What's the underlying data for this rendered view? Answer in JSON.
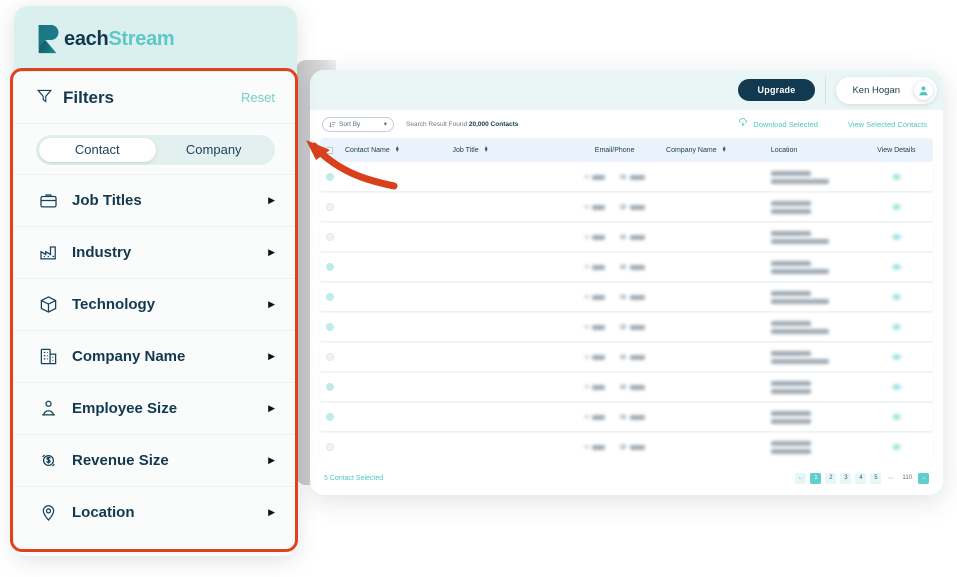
{
  "brand": {
    "logo_text_primary": "each",
    "logo_text_secondary": "Stream",
    "logo_mark": "reachstream-r-logo",
    "color_dark": "#12394f",
    "color_teal": "#5fc8c7",
    "annotation_color": "#e0421a"
  },
  "sidebar": {
    "filters_title": "Filters",
    "filters_icon": "funnel-icon",
    "reset_label": "Reset",
    "toggle": {
      "options": [
        "Contact",
        "Company"
      ],
      "selected": "Contact"
    },
    "items": [
      {
        "label": "Job Titles",
        "icon": "briefcase-icon",
        "chevron": "▶"
      },
      {
        "label": "Industry",
        "icon": "factory-icon",
        "chevron": "▶"
      },
      {
        "label": "Technology",
        "icon": "cube-stack-icon",
        "chevron": "▶"
      },
      {
        "label": "Company Name",
        "icon": "building-icon",
        "chevron": "▶"
      },
      {
        "label": "Employee Size",
        "icon": "person-group-icon",
        "chevron": "▶"
      },
      {
        "label": "Revenue Size",
        "icon": "dollar-circle-icon",
        "chevron": "▶"
      },
      {
        "label": "Location",
        "icon": "map-pin-icon",
        "chevron": "▶"
      }
    ]
  },
  "topbar": {
    "upgrade_label": "Upgrade",
    "user_name": "Ken Hogan",
    "user_avatar_icon": "user-avatar-icon"
  },
  "toolbar": {
    "sort_by_label": "Sort By",
    "sort_by_icon": "sort-icon",
    "sort_by_caret": "▾",
    "result_prefix": "Search Result Found",
    "result_count": "20,000 Contacts",
    "download_label": "Download Selected",
    "download_icon": "cloud-download-icon",
    "view_selected_label": "View Selected Contacts"
  },
  "table": {
    "columns": [
      {
        "label": "Contact Name",
        "sortable": true
      },
      {
        "label": "Job Title",
        "sortable": true
      },
      {
        "label": "Email/Phone",
        "sortable": false
      },
      {
        "label": "Company Name",
        "sortable": true
      },
      {
        "label": "Location",
        "sortable": false
      },
      {
        "label": "View Details",
        "sortable": false
      }
    ],
    "sort_glyph_up": "▴",
    "sort_glyph_down": "▾",
    "email_label": "Email",
    "phone_label": "Phone",
    "rows_note": "row contact values are obscured/blurred in the source screenshot",
    "rows": [
      {
        "selected": true,
        "name_w": 62,
        "title_w": 78,
        "company_w": 54,
        "loc1_w": 40,
        "loc2_w": 58
      },
      {
        "selected": false,
        "name_w": 48,
        "title_w": 32,
        "company_w": 34,
        "loc1_w": 40,
        "loc2_w": 40
      },
      {
        "selected": false,
        "name_w": 52,
        "title_w": 26,
        "company_w": 20,
        "loc1_w": 40,
        "loc2_w": 58
      },
      {
        "selected": true,
        "name_w": 40,
        "title_w": 70,
        "company_w": 48,
        "loc1_w": 40,
        "loc2_w": 58
      },
      {
        "selected": true,
        "name_w": 54,
        "title_w": 26,
        "company_w": 52,
        "loc1_w": 40,
        "loc2_w": 58
      },
      {
        "selected": true,
        "name_w": 46,
        "title_w": 78,
        "company_w": 54,
        "loc1_w": 40,
        "loc2_w": 58
      },
      {
        "selected": false,
        "name_w": 52,
        "title_w": 78,
        "company_w": 54,
        "loc1_w": 40,
        "loc2_w": 58
      },
      {
        "selected": true,
        "name_w": 48,
        "title_w": 32,
        "company_w": 34,
        "loc1_w": 40,
        "loc2_w": 40
      },
      {
        "selected": true,
        "name_w": 48,
        "title_w": 32,
        "company_w": 34,
        "loc1_w": 40,
        "loc2_w": 40
      },
      {
        "selected": false,
        "name_w": 48,
        "title_w": 32,
        "company_w": 34,
        "loc1_w": 40,
        "loc2_w": 40
      }
    ]
  },
  "footer": {
    "selected_label": "5 Contact Selected",
    "pagination": {
      "prev_glyph": "←",
      "next_glyph": "→",
      "pages": [
        "1",
        "2",
        "3",
        "4",
        "5"
      ],
      "ellipsis": "⋯",
      "last_page": "110",
      "current": "1"
    }
  },
  "annotation": {
    "type": "red-highlight-box-with-arrow",
    "target": "filters-sidebar"
  }
}
